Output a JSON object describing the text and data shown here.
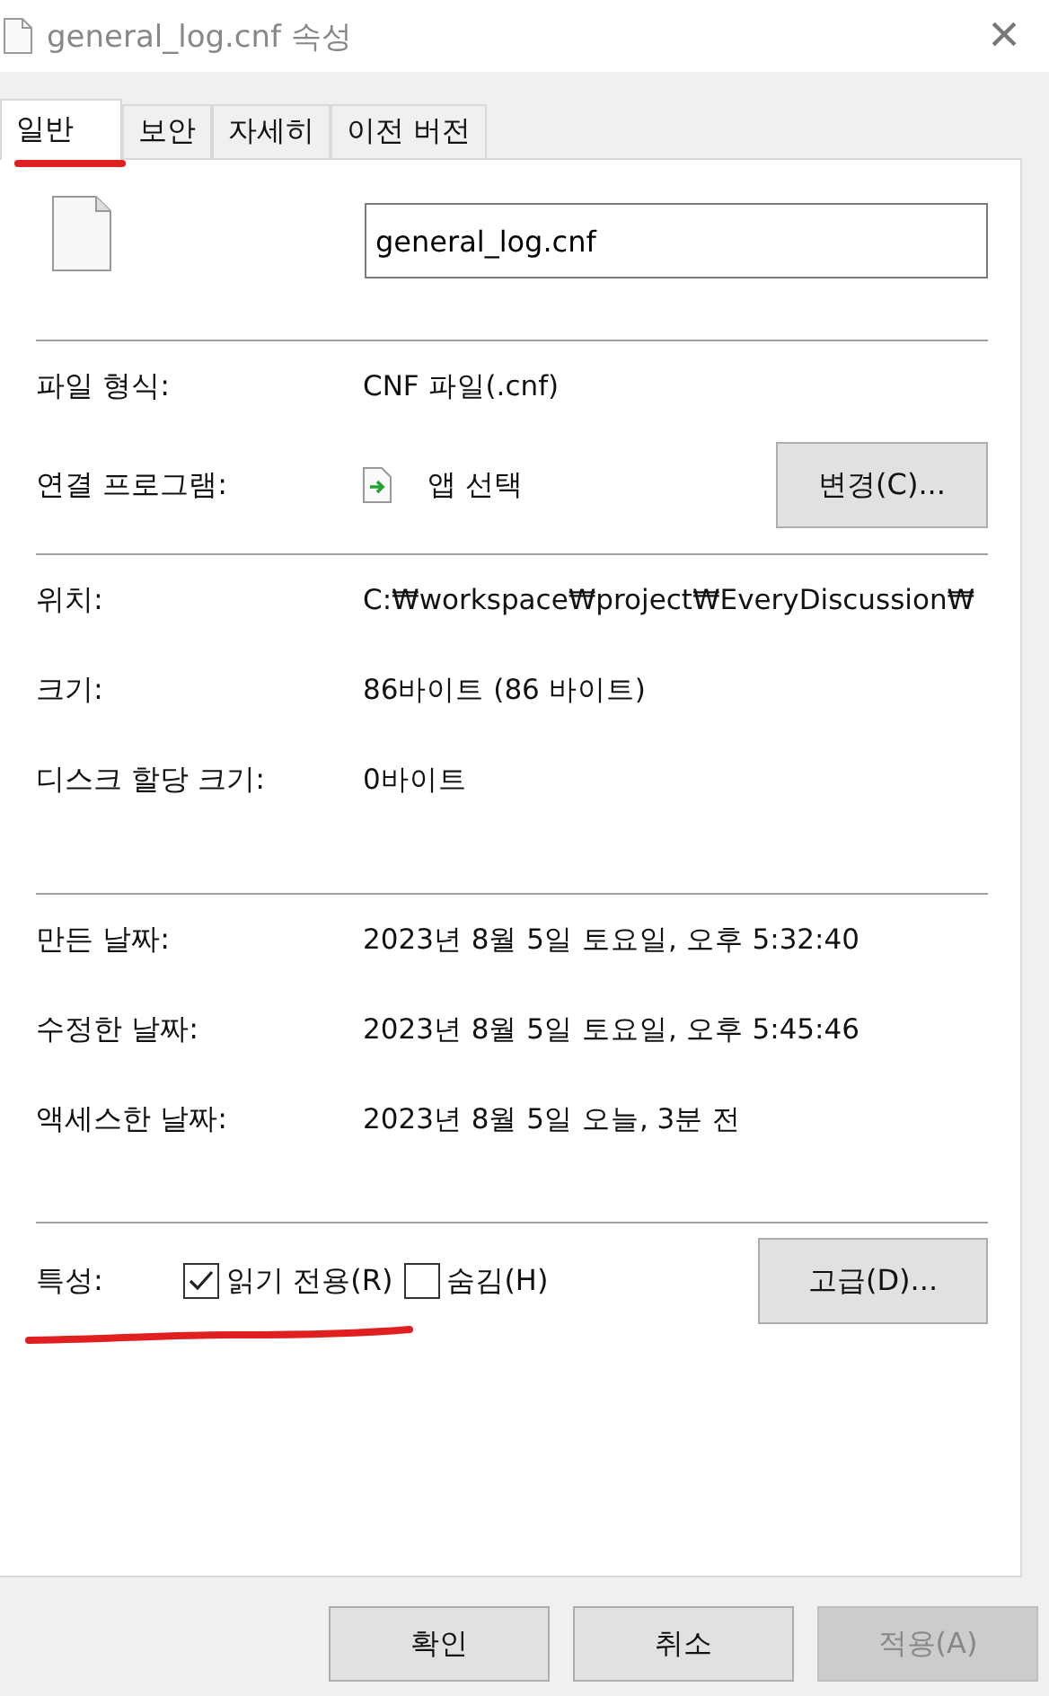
{
  "window": {
    "title": "general_log.cnf 속성",
    "close": "×"
  },
  "tabs": [
    {
      "label": "일반",
      "selected": true
    },
    {
      "label": "보안",
      "selected": false
    },
    {
      "label": "자세히",
      "selected": false
    },
    {
      "label": "이전 버전",
      "selected": false
    }
  ],
  "file_name": "general_log.cnf",
  "type_section": {
    "file_type_label": "파일 형식:",
    "file_type": "CNF 파일(.cnf)",
    "opens_with_label": "연결 프로그램:",
    "opens_with": "앱 선택",
    "change_button": "변경(C)..."
  },
  "location_section": [
    {
      "label": "위치:",
      "value": "C:₩workspace₩project₩EveryDiscussion₩"
    },
    {
      "label": "크기:",
      "value": "86바이트 (86 바이트)"
    },
    {
      "label": "디스크 할당 크기:",
      "value": "0바이트"
    }
  ],
  "dates_section": [
    {
      "label": "만든 날짜:",
      "value": "2023년 8월 5일 토요일, 오후 5:32:40"
    },
    {
      "label": "수정한 날짜:",
      "value": "2023년 8월 5일 토요일, 오후 5:45:46"
    },
    {
      "label": "액세스한 날짜:",
      "value": "2023년 8월 5일 오늘, 3분 전"
    }
  ],
  "attributes": {
    "label": "특성:",
    "options": [
      {
        "label": "읽기 전용(R)",
        "checked": true
      },
      {
        "label": "숨김(H)",
        "checked": false
      }
    ],
    "advanced_button": "고급(D)..."
  },
  "buttons": [
    {
      "label": "확인",
      "disabled": false
    },
    {
      "label": "취소",
      "disabled": false
    },
    {
      "label": "적용(A)",
      "disabled": true
    }
  ]
}
